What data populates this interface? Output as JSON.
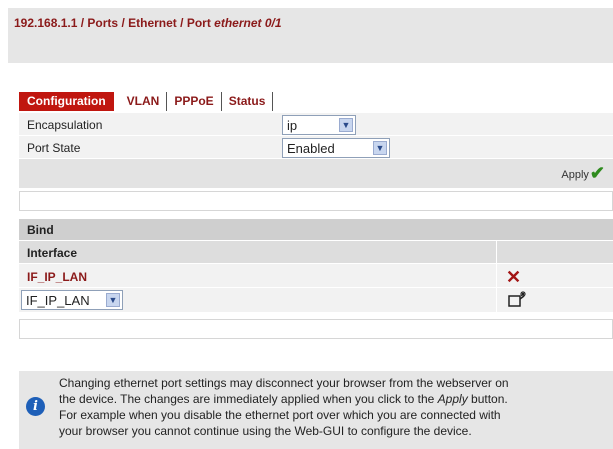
{
  "breadcrumb": {
    "host": "192.168.1.1",
    "sep": " / ",
    "p1": "Ports",
    "p2": "Ethernet",
    "p3_prefix": "Port ",
    "p3_italic": "ethernet 0/1"
  },
  "tabs": [
    "Configuration",
    "VLAN",
    "PPPoE",
    "Status"
  ],
  "form": {
    "encapsulation_label": "Encapsulation",
    "encapsulation_value": "ip",
    "port_state_label": "Port State",
    "port_state_value": "Enabled",
    "apply_label": "Apply"
  },
  "bind": {
    "title": "Bind",
    "column_header": "Interface",
    "rows": [
      "IF_IP_LAN"
    ],
    "new_select_value": "IF_IP_LAN"
  },
  "icons": {
    "delete": "x-icon",
    "add": "add-entry-icon",
    "info": "info-icon",
    "apply": "check-icon"
  },
  "info_text": {
    "line1": "Changing ethernet port settings may disconnect your browser from the webserver on",
    "line2_pre": "the device. The changes are immediately applied when you click to the ",
    "line2_em": "Apply",
    "line2_post": " button.",
    "line3": "For example when you disable the ethernet port over which you are connected with",
    "line4": "your browser you cannot continue using the Web-GUI to configure the device."
  }
}
